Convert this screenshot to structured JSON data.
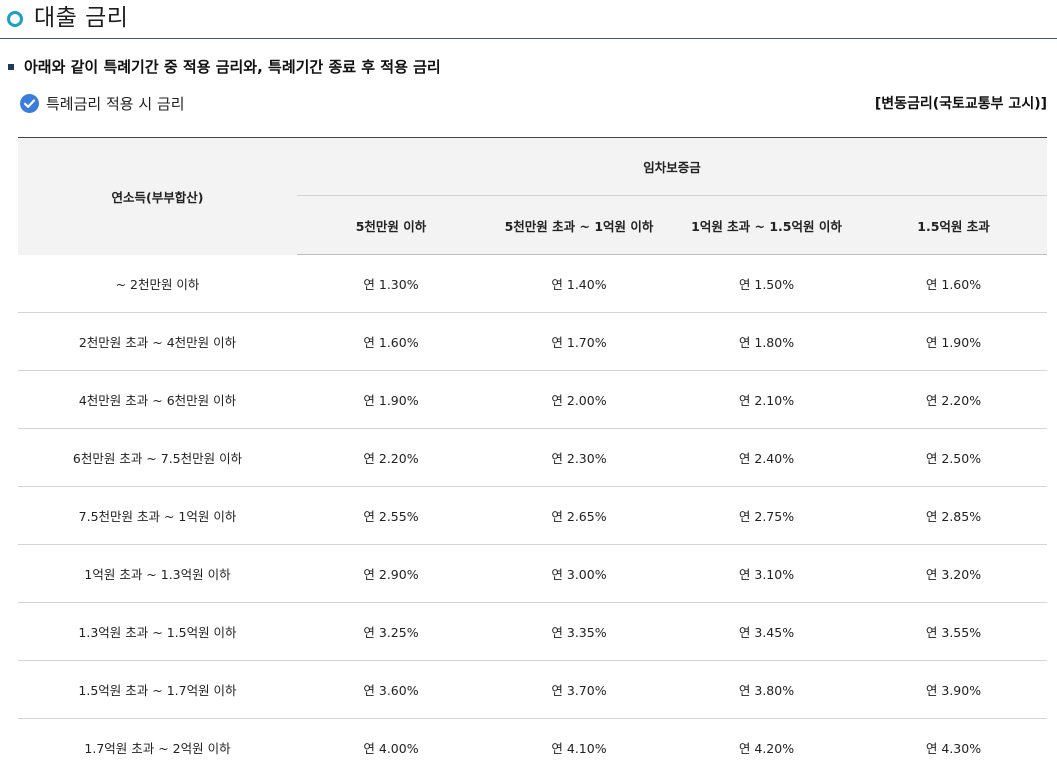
{
  "title": "대출 금리",
  "subtitle": "아래와 같이 특례기간 중 적용 금리와, 특례기간 종료 후 적용 금리",
  "section": {
    "label": "특례금리 적용 시 금리",
    "rate_type": "[변동금리(국토교통부 고시)]"
  },
  "table": {
    "row_header": "연소득(부부합산)",
    "group_header": "임차보증금",
    "columns": [
      "5천만원 이하",
      "5천만원 초과 ~ 1억원 이하",
      "1억원 초과 ~ 1.5억원 이하",
      "1.5억원 초과"
    ],
    "rows": [
      {
        "income": "~ 2천만원 이하",
        "rates": [
          "연 1.30%",
          "연 1.40%",
          "연 1.50%",
          "연 1.60%"
        ]
      },
      {
        "income": "2천만원 초과 ~ 4천만원 이하",
        "rates": [
          "연 1.60%",
          "연 1.70%",
          "연 1.80%",
          "연 1.90%"
        ]
      },
      {
        "income": "4천만원 초과 ~ 6천만원 이하",
        "rates": [
          "연 1.90%",
          "연 2.00%",
          "연 2.10%",
          "연 2.20%"
        ]
      },
      {
        "income": "6천만원 초과 ~ 7.5천만원 이하",
        "rates": [
          "연 2.20%",
          "연 2.30%",
          "연 2.40%",
          "연 2.50%"
        ]
      },
      {
        "income": "7.5천만원 초과 ~ 1억원 이하",
        "rates": [
          "연 2.55%",
          "연 2.65%",
          "연 2.75%",
          "연 2.85%"
        ]
      },
      {
        "income": "1억원 초과 ~ 1.3억원 이하",
        "rates": [
          "연 2.90%",
          "연 3.00%",
          "연 3.10%",
          "연 3.20%"
        ]
      },
      {
        "income": "1.3억원 초과 ~ 1.5억원 이하",
        "rates": [
          "연 3.25%",
          "연 3.35%",
          "연 3.45%",
          "연 3.55%"
        ]
      },
      {
        "income": "1.5억원 초과 ~ 1.7억원 이하",
        "rates": [
          "연 3.60%",
          "연 3.70%",
          "연 3.80%",
          "연 3.90%"
        ]
      },
      {
        "income": "1.7억원 초과 ~ 2억원 이하",
        "rates": [
          "연 4.00%",
          "연 4.10%",
          "연 4.20%",
          "연 4.30%"
        ]
      }
    ]
  },
  "icons": {
    "title": "ring-bullet-icon",
    "subtitle": "square-bullet-icon",
    "section": "check-circle-icon"
  },
  "colors": {
    "accent": "#1aa0c8",
    "check": "#3b7ddd",
    "header_bg": "#f3f3f3"
  }
}
